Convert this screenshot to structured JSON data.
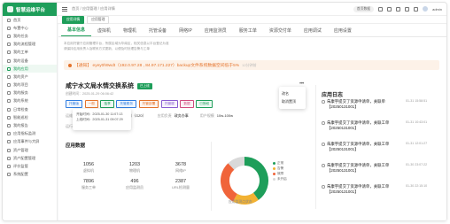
{
  "brand": {
    "name": "智慧运维平台"
  },
  "sidebar": {
    "items": [
      {
        "label": "首页"
      },
      {
        "label": "布置中心"
      },
      {
        "label": "我的任务"
      },
      {
        "label": "我的流程管理"
      },
      {
        "label": "我的工单"
      },
      {
        "label": "我的设备"
      },
      {
        "label": "我的应用",
        "active": true
      },
      {
        "label": "我的资产"
      },
      {
        "label": "我的项目"
      },
      {
        "label": "我的服务"
      },
      {
        "label": "我的系统"
      },
      {
        "label": "日常检查"
      },
      {
        "label": "智能巡检"
      },
      {
        "label": "我的报告"
      },
      {
        "label": "应用指标监测"
      },
      {
        "label": "应用事件与大屏"
      },
      {
        "label": "资产管理"
      },
      {
        "label": "资产配置管理"
      },
      {
        "label": "评价监管"
      },
      {
        "label": "系统配置"
      }
    ]
  },
  "topbar": {
    "breadcrumb": "首页 / 应用管理 / 应用详情",
    "pill": "首页数据",
    "user": "admin"
  },
  "page_tabs": [
    {
      "label": "应用详情",
      "active": true
    },
    {
      "label": "应用管理",
      "active": false
    }
  ],
  "tabs": [
    {
      "label": "基本信息",
      "active": true
    },
    {
      "label": "虚拟机"
    },
    {
      "label": "物理机"
    },
    {
      "label": "托管设备"
    },
    {
      "label": "网络IP"
    },
    {
      "label": "应用监测员"
    },
    {
      "label": "服务工单"
    },
    {
      "label": "资源交付单"
    },
    {
      "label": "应用调试"
    },
    {
      "label": "应用设置"
    }
  ],
  "alert_lines": [
    "本应用托管于应用管理平台，所属区域为华南区，相关信息以平台登记为准",
    "请保持应用负责人及联系方式更新，以便及时处理告警与工单"
  ],
  "notice": {
    "text": "【通知】 eyey0h9wdt（192.0.97.28 , 84.97.171.227）backup文件系统数据空间低于5%",
    "time": "12分钟前"
  },
  "app": {
    "title": "咸宁水文局水情交换系统",
    "status": "已上线",
    "subtitle": "创建时间：2025-01-29 06:06:42",
    "tags": [
      {
        "label": "托管版",
        "color": "#2f7de1"
      },
      {
        "label": "一般",
        "color": "#e4732b"
      },
      {
        "label": "独享",
        "color": "#1e9e5a"
      },
      {
        "label": "托管服务",
        "color": "#2f7de1"
      },
      {
        "label": "托管部署",
        "color": "#e4732b"
      },
      {
        "label": "托管服",
        "color": "#8a5cd1"
      },
      {
        "label": "数据",
        "color": "#d14b7e"
      },
      {
        "label": "已授权",
        "color": "#1e9e5a"
      }
    ],
    "fields": [
      {
        "k": "运维部门",
        "v": "政府与企事业单位组织电子信息（GZ0）"
      },
      {
        "k": "应用负责",
        "v": "政务办事"
      },
      {
        "k": "用户规模",
        "v": "10w-100w"
      }
    ],
    "state_label": "运行状态",
    "state_value": "已上线"
  },
  "popover": {
    "lines": [
      "开始时间：2025-01-30 11:07:13",
      "上线时间：2025-01-31 09:07:29"
    ]
  },
  "more_menu": {
    "items": [
      "改名",
      "取消置顶"
    ]
  },
  "stats": {
    "title": "应用数据",
    "cells": [
      {
        "n": "1056",
        "l": "虚拟机"
      },
      {
        "n": "1203",
        "l": "物理机"
      },
      {
        "n": "3678",
        "l": "网络IP"
      },
      {
        "n": "7896",
        "l": "服务工单"
      },
      {
        "n": "496",
        "l": "应用监测员"
      },
      {
        "n": "2387",
        "l": "URL检测量"
      }
    ]
  },
  "donut": {
    "caption": "应用监测点状态",
    "segments": [
      {
        "name": "正常",
        "value": 40,
        "color": "#1e9e5a"
      },
      {
        "name": "告警",
        "value": 18,
        "color": "#f2b233"
      },
      {
        "name": "故障",
        "value": 30,
        "color": "#f0643a"
      },
      {
        "name": "未开启",
        "value": 12,
        "color": "#d9d9d9"
      }
    ]
  },
  "logs": {
    "title": "应用日志",
    "items": [
      {
        "text": "朱康宇提交了资源申请单，关联单【20250131001】",
        "date": "01-31 15:58:51"
      },
      {
        "text": "朱康宇提交了资源申请单，关联工单【20250131001】",
        "date": "01-31 10:43:01"
      },
      {
        "text": "朱康宇提交了资源申请单，关联工单【20250131001】",
        "date": "01-31 12:01:27"
      },
      {
        "text": "朱康宇提交了资源申请单，关联工单【20250131001】",
        "date": "01-30 23:07:22"
      },
      {
        "text": "朱康宇提交了资源申请单，关联工单【20250131001】",
        "date": "01-30 22:15:10"
      }
    ]
  }
}
